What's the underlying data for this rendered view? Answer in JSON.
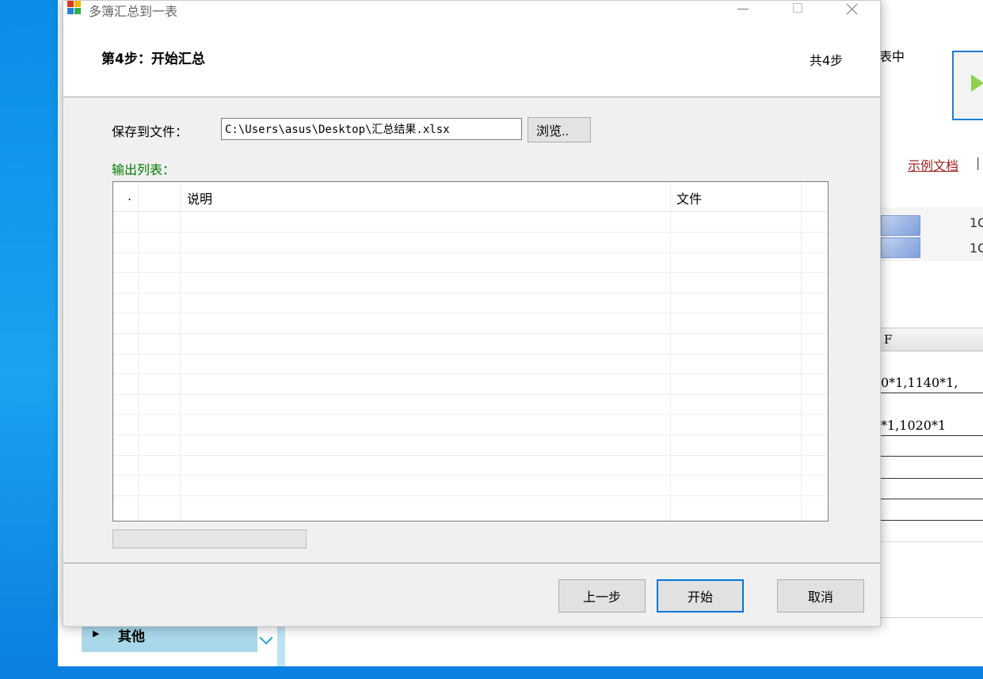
{
  "dialog": {
    "title": "多簿汇总到一表",
    "step_title": "第4步：开始汇总",
    "step_total": "共4步",
    "save_label": "保存到文件：",
    "save_path": "C:\\Users\\asus\\Desktop\\汇总结果.xlsx",
    "browse_label": "浏览..",
    "output_label": "输出列表：",
    "table": {
      "columns": [
        ".",
        "",
        "说明",
        "文件",
        ""
      ],
      "rows": []
    },
    "progress": 0,
    "buttons": {
      "prev": "上一步",
      "start": "开始",
      "cancel": "取消"
    }
  },
  "background_window": {
    "text_biaozhong": "表中",
    "example_link": "示例文档",
    "separator": "|",
    "numbers": [
      "1C",
      "1C"
    ],
    "column_header": "F",
    "cell_values": [
      "0*1,1140*1,",
      "*1,1020*1"
    ],
    "sidebar_item": "其他"
  },
  "colors": {
    "accent": "#0078d7",
    "output_label": "#007a00",
    "link": "#9b1e1e",
    "desktop": "#1aa3f0"
  }
}
